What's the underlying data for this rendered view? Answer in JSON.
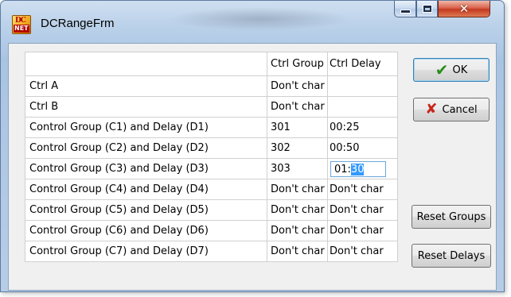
{
  "window": {
    "title": "DCRangeFrm",
    "icon": {
      "name": "dcnet-app-icon",
      "top_text": "DC",
      "bottom_text": "NET"
    }
  },
  "caption": {
    "minimize_icon": "minimize-icon",
    "maximize_icon": "maximize-icon",
    "close_icon": "close-icon",
    "close_glyph": "✕"
  },
  "grid": {
    "headers": [
      "",
      "Ctrl Group",
      "Ctrl Delay"
    ],
    "rows": [
      {
        "label": "Ctrl A",
        "group": "Don't char",
        "delay": ""
      },
      {
        "label": "Ctrl B",
        "group": "Don't char",
        "delay": ""
      },
      {
        "label": "Control Group (C1) and Delay (D1)",
        "group": "301",
        "delay": "00:25"
      },
      {
        "label": "Control Group (C2) and Delay (D2)",
        "group": "302",
        "delay": "00:50"
      },
      {
        "label": "Control Group (C3) and Delay (D3)",
        "group": "303",
        "delay_prefix": "01:",
        "delay_selected": "30"
      },
      {
        "label": "Control Group (C4) and Delay (D4)",
        "group": "Don't char",
        "delay": "Don't char"
      },
      {
        "label": "Control Group (C5) and Delay (D5)",
        "group": "Don't char",
        "delay": "Don't char"
      },
      {
        "label": "Control Group (C6) and Delay (D6)",
        "group": "Don't char",
        "delay": "Don't char"
      },
      {
        "label": "Control Group (C7) and Delay (D7)",
        "group": "Don't char",
        "delay": "Don't char"
      }
    ]
  },
  "buttons": {
    "ok": {
      "label": "OK",
      "icon": "check-icon",
      "glyph": "✔"
    },
    "cancel": {
      "label": "Cancel",
      "icon": "x-icon",
      "glyph": "✘"
    },
    "reset_groups": {
      "label": "Reset Groups"
    },
    "reset_delays": {
      "label": "Reset Delays"
    }
  }
}
